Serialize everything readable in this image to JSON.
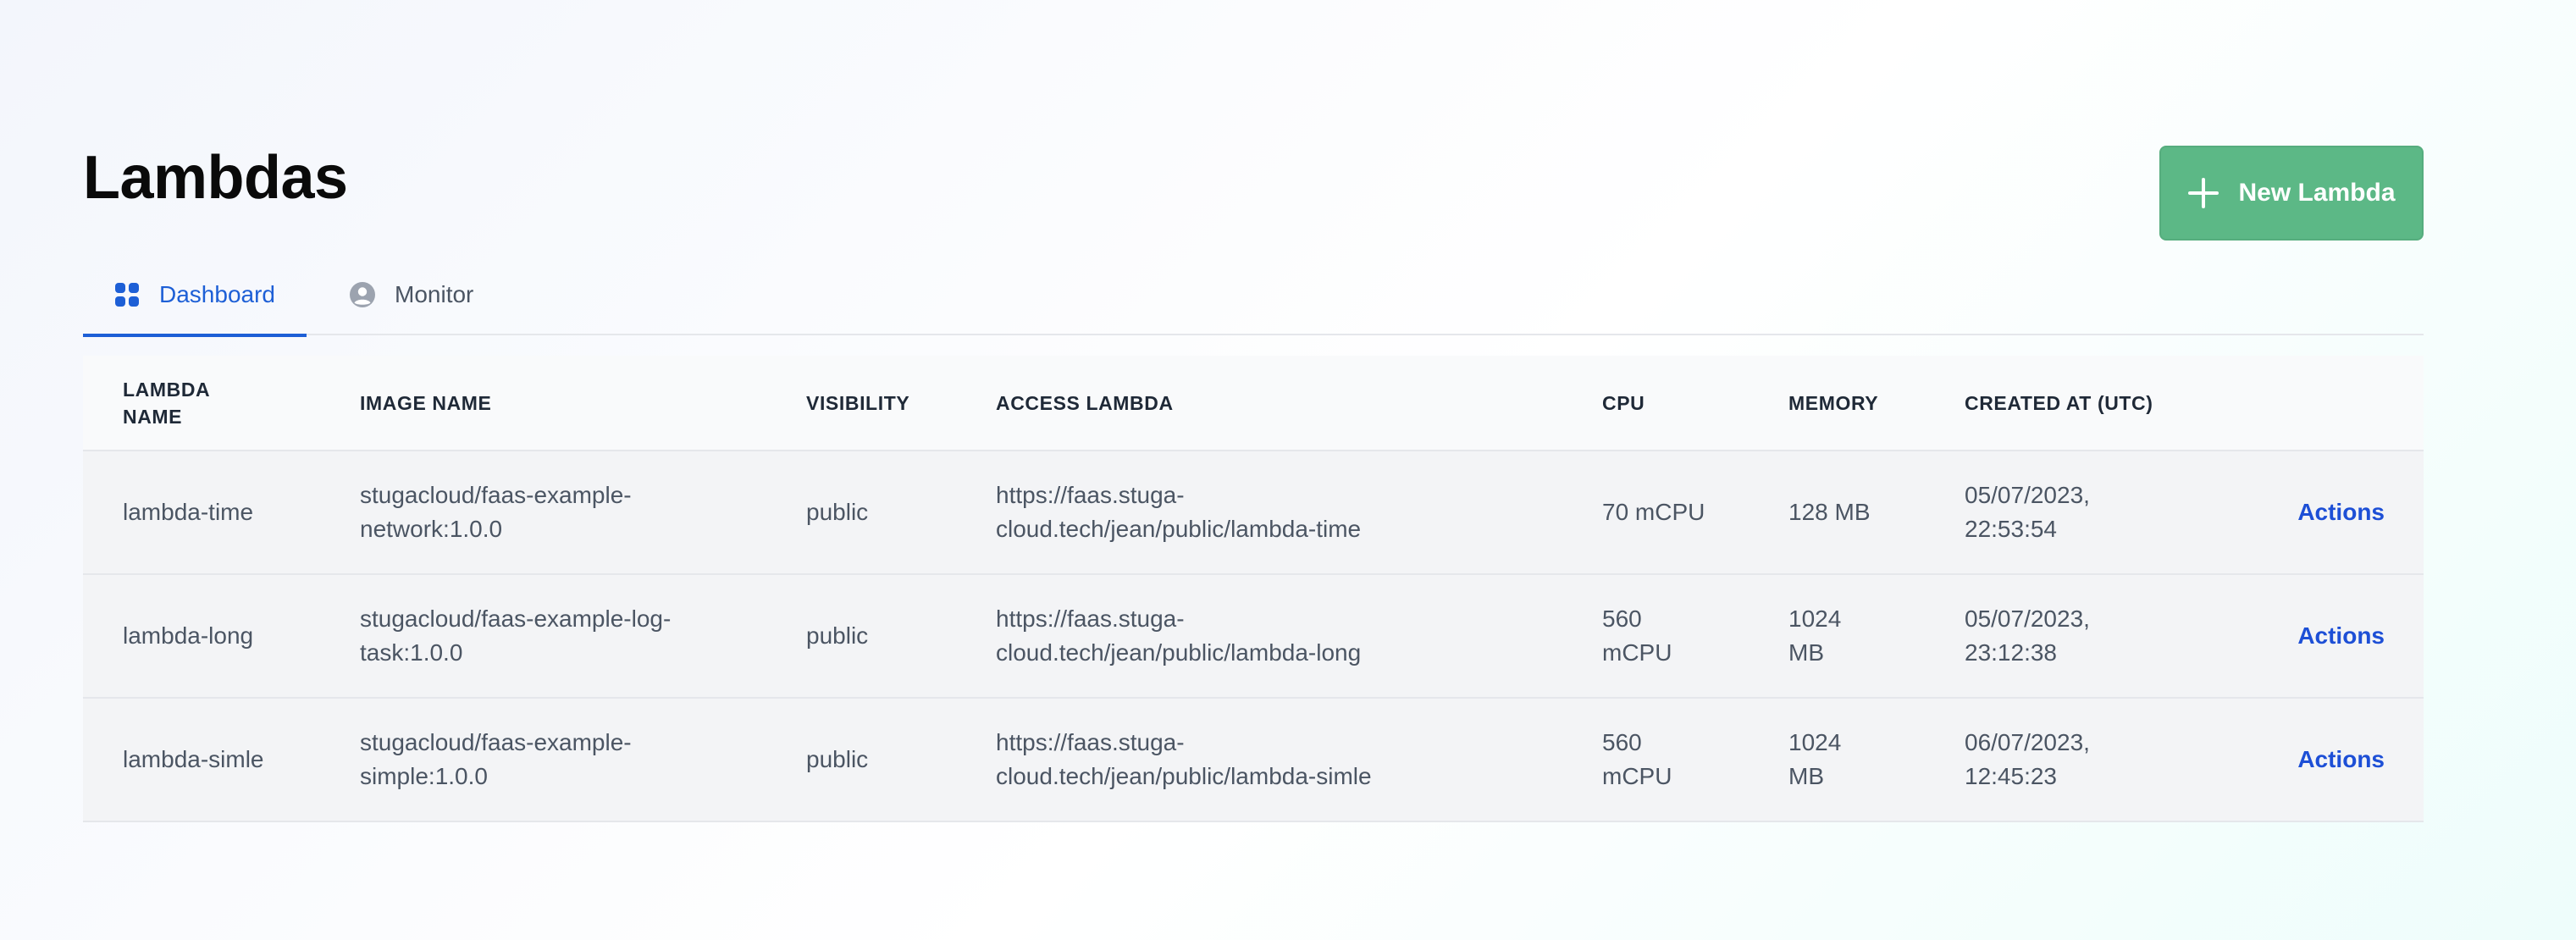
{
  "page": {
    "title": "Lambdas",
    "new_button_label": "New Lambda"
  },
  "tabs": [
    {
      "label": "Dashboard",
      "icon": "grid-icon",
      "active": true
    },
    {
      "label": "Monitor",
      "icon": "user-circle-icon",
      "active": false
    }
  ],
  "table": {
    "headers": {
      "name_line1": "LAMBDA",
      "name_line2": "NAME",
      "image": "IMAGE NAME",
      "visibility": "VISIBILITY",
      "access": "ACCESS LAMBDA",
      "cpu": "CPU",
      "memory": "MEMORY",
      "created": "CREATED AT (UTC)"
    },
    "rows": [
      {
        "name": "lambda-time",
        "image_line1": "stugacloud/faas-example-",
        "image_line2": "network:1.0.0",
        "visibility": "public",
        "access_line1": "https://faas.stuga-",
        "access_line2": "cloud.tech/jean/public/lambda-time",
        "cpu_line1": "70 mCPU",
        "cpu_line2": "",
        "memory_line1": "128 MB",
        "memory_line2": "",
        "created_line1": "05/07/2023,",
        "created_line2": "22:53:54",
        "action": "Actions"
      },
      {
        "name": "lambda-long",
        "image_line1": "stugacloud/faas-example-log-",
        "image_line2": "task:1.0.0",
        "visibility": "public",
        "access_line1": "https://faas.stuga-",
        "access_line2": "cloud.tech/jean/public/lambda-long",
        "cpu_line1": "560",
        "cpu_line2": "mCPU",
        "memory_line1": "1024",
        "memory_line2": "MB",
        "created_line1": "05/07/2023,",
        "created_line2": "23:12:38",
        "action": "Actions"
      },
      {
        "name": "lambda-simle",
        "image_line1": "stugacloud/faas-example-",
        "image_line2": "simple:1.0.0",
        "visibility": "public",
        "access_line1": "https://faas.stuga-",
        "access_line2": "cloud.tech/jean/public/lambda-simle",
        "cpu_line1": "560",
        "cpu_line2": "mCPU",
        "memory_line1": "1024",
        "memory_line2": "MB",
        "created_line1": "06/07/2023,",
        "created_line2": "12:45:23",
        "action": "Actions"
      }
    ]
  },
  "colors": {
    "accent_blue": "#1d5fd6",
    "button_green": "#5cb886"
  }
}
